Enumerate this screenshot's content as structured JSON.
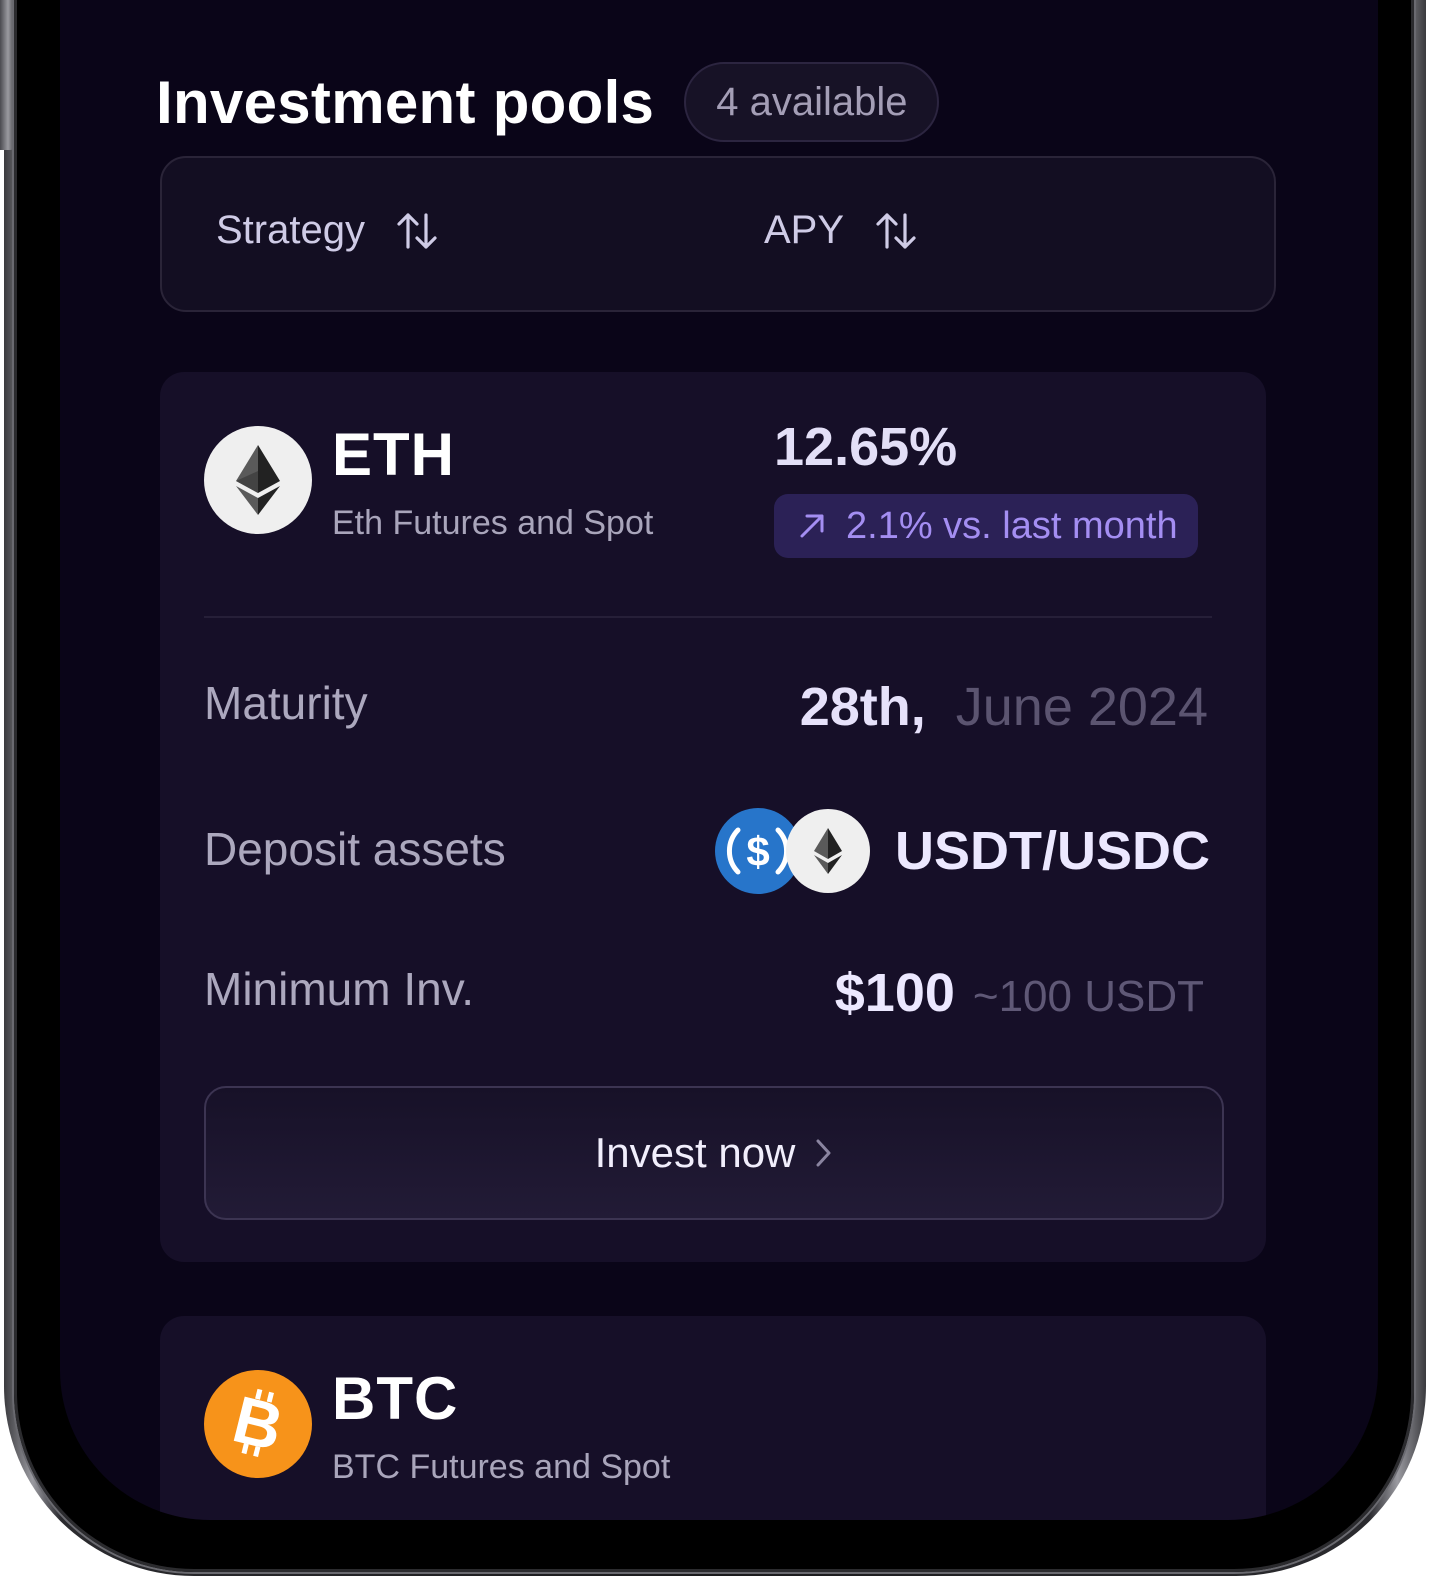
{
  "header": {
    "title": "Investment pools",
    "count_badge": "4 available"
  },
  "sort_bar": {
    "strategy_label": "Strategy",
    "apy_label": "APY"
  },
  "pools": [
    {
      "symbol": "ETH",
      "description": "Eth Futures and Spot",
      "apy": "12.65%",
      "trend": "2.1% vs. last month",
      "maturity_label": "Maturity",
      "maturity_day": "28th,",
      "maturity_rest": "June 2024",
      "deposit_label": "Deposit assets",
      "deposit_value": "USDT/USDC",
      "min_label": "Minimum Inv.",
      "min_value": "$100",
      "min_sub": "~100 USDT",
      "button_label": "Invest now",
      "icon": "ethereum-icon"
    },
    {
      "symbol": "BTC",
      "description": "BTC Futures and Spot",
      "icon": "bitcoin-icon"
    }
  ],
  "colors": {
    "background": "#0a0518",
    "card": "#160f28",
    "accent": "#a48ef2",
    "badge_bg": "#2b2156",
    "btc_orange": "#f7931a",
    "usdc_blue": "#2775ca"
  }
}
